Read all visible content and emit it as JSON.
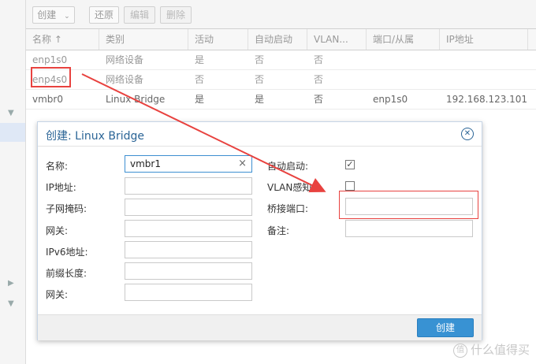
{
  "toolbar": {
    "create_label": "创建",
    "revert_label": "还原",
    "edit_label": "编辑",
    "delete_label": "删除"
  },
  "grid": {
    "columns": [
      "名称 ↑",
      "类别",
      "活动",
      "自动启动",
      "VLAN...",
      "端口/从属",
      "IP地址"
    ],
    "rows": [
      {
        "name": "enp1s0",
        "type": "网络设备",
        "active": "是",
        "autostart": "否",
        "vlan": "否",
        "ports": "",
        "ip": ""
      },
      {
        "name": "enp4s0",
        "type": "网络设备",
        "active": "否",
        "autostart": "否",
        "vlan": "否",
        "ports": "",
        "ip": ""
      },
      {
        "name": "vmbr0",
        "type": "Linux Bridge",
        "active": "是",
        "autostart": "是",
        "vlan": "否",
        "ports": "enp1s0",
        "ip": "192.168.123.101"
      }
    ]
  },
  "dialog": {
    "title": "创建: Linux Bridge",
    "fields": {
      "name_label": "名称:",
      "name_value": "vmbr1",
      "ip_label": "IP地址:",
      "subnet_label": "子网掩码:",
      "gateway_label": "网关:",
      "ipv6_label": "IPv6地址:",
      "prefix_label": "前缀长度:",
      "gateway6_label": "网关:",
      "autostart_label": "自动启动:",
      "autostart_checked": true,
      "vlan_label": "VLAN感知:",
      "vlan_checked": false,
      "bridge_ports_label": "桥接端口:",
      "comment_label": "备注:"
    },
    "create_button": "创建"
  },
  "watermark": "什么值得买",
  "colors": {
    "accent": "#3892d3",
    "highlight": "#e8423f",
    "title": "#2a6496"
  }
}
